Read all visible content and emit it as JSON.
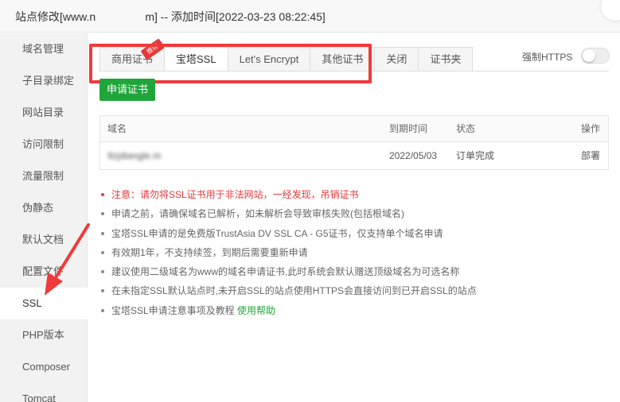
{
  "window": {
    "title": "站点修改[www.n                m] -- 添加时间[2022-03-23 08:22:45]"
  },
  "sidebar": {
    "items": [
      {
        "label": "域名管理"
      },
      {
        "label": "子目录绑定"
      },
      {
        "label": "网站目录"
      },
      {
        "label": "访问限制"
      },
      {
        "label": "流量限制"
      },
      {
        "label": "伪静态"
      },
      {
        "label": "默认文档"
      },
      {
        "label": "配置文件"
      },
      {
        "label": "SSL"
      },
      {
        "label": "PHP版本"
      },
      {
        "label": "Composer"
      },
      {
        "label": "Tomcat"
      }
    ],
    "active": "SSL"
  },
  "tabs": {
    "items": [
      {
        "label": "商用证书",
        "badge": "推荐"
      },
      {
        "label": "宝塔SSL"
      },
      {
        "label": "Let's Encrypt"
      },
      {
        "label": "其他证书"
      },
      {
        "label": "关闭"
      },
      {
        "label": "证书夹"
      }
    ],
    "active": "宝塔SSL"
  },
  "force_https": {
    "label": "强制HTTPS",
    "enabled": false
  },
  "apply_button": {
    "label": "申请证书"
  },
  "table": {
    "headers": {
      "domain": "域名",
      "expire": "到期时间",
      "status": "状态",
      "action": "操作"
    },
    "rows": [
      {
        "domain": "9zjdiangle.m",
        "expire": "2022/05/03",
        "status": "订单完成",
        "action": "部署"
      }
    ]
  },
  "notes": {
    "warning": "注意：请勿将SSL证书用于非法网站，一经发现，吊销证书",
    "items": [
      "申请之前，请确保域名已解析，如未解析会导致审核失败(包括根域名)",
      "宝塔SSL申请的是免费版TrustAsia DV SSL CA - G5证书，仅支持单个域名申请",
      "有效期1年，不支持续签，到期后需要重新申请",
      "建议使用二级域名为www的域名申请证书,此时系统会默认赠送顶级域名为可选名称",
      "在未指定SSL默认站点时,未开启SSL的站点使用HTTPS会直接访问到已开启SSL的站点"
    ],
    "help_text": "宝塔SSL申请注意事项及教程",
    "help_link": "使用帮助"
  },
  "colors": {
    "accent_green": "#20a53a",
    "warning_red": "#e4393c",
    "annotation_red": "#f03a3a"
  }
}
